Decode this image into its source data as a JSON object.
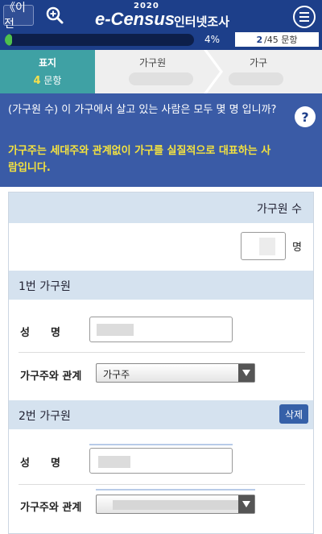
{
  "header": {
    "back_label": "《이전",
    "zoom_icon": "zoom-in-icon",
    "logo_year": "2020",
    "logo_brand": "e-Census",
    "logo_sub": "인터넷조사",
    "menu_icon": "menu-icon",
    "progress_fraction": 0.04,
    "progress_label": "4%",
    "current_question": "2",
    "total_questions": "/45 문항"
  },
  "steps": {
    "active": {
      "title": "표지",
      "count": "4",
      "unit": "문항"
    },
    "items": [
      {
        "label": "가구원"
      },
      {
        "label": "가구"
      }
    ]
  },
  "question": {
    "text": "(가구원 수) 이 가구에서 살고 있는 사람은 모두 몇 명 입니까?",
    "hint": "가구주는 세대주와 관계없이 가구를 실질적으로 대표하는 사람입니다.",
    "help_label": "?"
  },
  "form": {
    "count_header": "가구원 수",
    "count_unit": "명",
    "members": [
      {
        "title": "1번 가구원",
        "name_label": "성　　명",
        "relation_label": "가구주와 관계",
        "relation_value": "가구주"
      },
      {
        "title": "2번 가구원",
        "delete_label": "삭제",
        "name_label": "성　　명",
        "relation_label": "가구주와 관계"
      }
    ]
  },
  "colors": {
    "header_bg": "#1d3f8a",
    "step_active": "#3fa1a4",
    "question_bg": "#3a5ba6",
    "hint_text": "#f4e23f",
    "band_bg": "#d5e2ef",
    "progress_fill": "#4ec04e"
  }
}
